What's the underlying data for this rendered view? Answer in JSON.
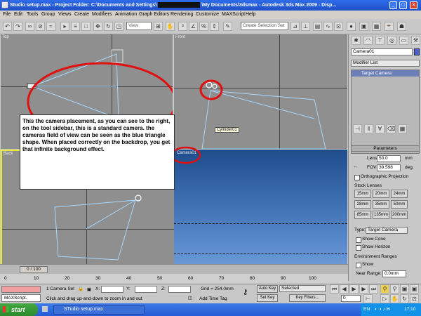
{
  "window": {
    "title_left": "Studio setup.max   - Project Folder: C:\\Documents and Settings\\",
    "title_right": "\\My Documents\\3dsmax    - Autodesk 3ds Max  2009      - Disp...",
    "minimize": "_",
    "maximize": "□",
    "close": "×"
  },
  "menu": [
    "File",
    "Edit",
    "Tools",
    "Group",
    "Views",
    "Create",
    "Modifiers",
    "Animation",
    "Graph Editors",
    "Rendering",
    "Customize",
    "MAXScript",
    "Help"
  ],
  "toolbar": {
    "view_select": "View",
    "selection_set": "Create Selection Set"
  },
  "viewports": {
    "top_label": "Top",
    "front_label": "Front",
    "back_label": "Back",
    "camera_label": "Camera01",
    "object_tooltip": "Cylinder01"
  },
  "note": "This the camera placement, as you can see to the right, on the tool sidebar, this is a standard camera. the cameras field of view can be seen as the blue triangle shape.  When placed correctly on the backdrop, you get that infinite background effect.",
  "panel": {
    "object_name": "Camera01",
    "modifier_list": "Modifier List",
    "stack_item": "Target Camera",
    "parameters_title": "Parameters",
    "lens_label": "Lens:",
    "lens_value": "50.0",
    "lens_unit": "mm",
    "fov_label": "FOV:",
    "fov_value": "39.598",
    "fov_unit": "deg.",
    "ortho_label": "Orthographic Projection",
    "stock_lenses_title": "Stock Lenses",
    "lenses": [
      "15mm",
      "20mm",
      "24mm",
      "28mm",
      "35mm",
      "50mm",
      "85mm",
      "135mm",
      "200mm"
    ],
    "type_label": "Type:",
    "type_value": "Target Camera",
    "show_cone": "Show Cone",
    "show_horizon": "Show Horizon",
    "env_ranges_title": "Environment Ranges",
    "show_label": "Show",
    "near_range_label": "Near Range:",
    "near_range_value": "0.0mm"
  },
  "timeline": {
    "frame_counter": "0 / 100",
    "ticks": [
      "0",
      "10",
      "20",
      "30",
      "40",
      "50",
      "60",
      "70",
      "80",
      "90",
      "100"
    ]
  },
  "status": {
    "selection_count": "1 Camera Sel",
    "x_label": "X:",
    "y_label": "Y:",
    "z_label": "Z:",
    "grid": "Grid = 254.0mm",
    "auto_key": "Auto Key",
    "set_key": "Set Key",
    "key_mode": "Selected",
    "key_filters": "Key Filters...",
    "frame_value": "0",
    "prompt": "Click and drag up-and-down to zoom in and out",
    "add_time_tag": "Add Time Tag",
    "maxscript": "MAXScript."
  },
  "taskbar": {
    "start": "start",
    "task": "STudio setup.max",
    "language": "EN",
    "clock": "17:10"
  }
}
